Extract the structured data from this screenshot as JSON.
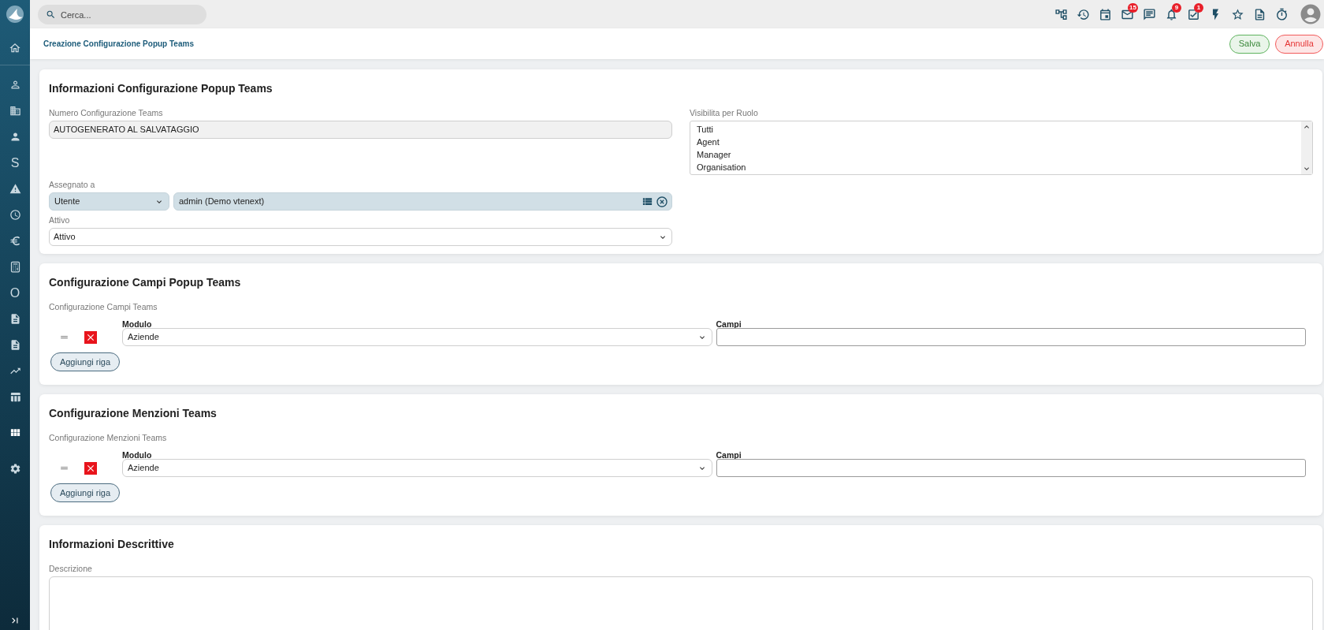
{
  "sidebar": {
    "items": [
      {
        "kind": "icon"
      },
      {
        "kind": "icon"
      },
      {
        "kind": "icon"
      },
      {
        "kind": "letter",
        "label": "S"
      },
      {
        "kind": "icon"
      },
      {
        "kind": "icon"
      },
      {
        "kind": "icon"
      },
      {
        "kind": "icon"
      },
      {
        "kind": "letter",
        "label": "O"
      },
      {
        "kind": "icon"
      },
      {
        "kind": "icon"
      },
      {
        "kind": "icon"
      },
      {
        "kind": "icon"
      }
    ]
  },
  "top_bar": {
    "search": {
      "placeholder": "Cerca..."
    },
    "badges": {
      "mail": "15",
      "notifications": "9",
      "tasks": "1"
    }
  },
  "header": {
    "title": "Creazione Configurazione Popup Teams",
    "buttons": [
      {
        "label": "Salva",
        "kind": "save"
      },
      {
        "label": "Annulla",
        "kind": "cancel"
      }
    ]
  },
  "sections": [
    {
      "title": "Informazioni Configurazione Popup Teams",
      "kind": "form",
      "rows": [
        [
          {
            "kind": "readonly",
            "label": "Numero Configurazione Teams",
            "value": "AUTOGENERATO AL SALVATAGGIO"
          },
          {
            "kind": "listbox",
            "label": "Visibilita per Ruolo",
            "options": [
              {
                "label": "Tutti",
                "selected": false
              },
              {
                "label": "Agent",
                "selected": false
              },
              {
                "label": "Manager",
                "selected": false
              },
              {
                "label": "Organisation",
                "selected": false
              }
            ]
          }
        ],
        [
          {
            "kind": "assignee",
            "label": "Assegnato a",
            "assignee_type": "Utente",
            "value": "admin (Demo vtenext)"
          }
        ],
        [
          {
            "kind": "select",
            "label": "Attivo",
            "value": "Attivo"
          }
        ]
      ]
    },
    {
      "title": "Configurazione Campi Popup Teams",
      "kind": "table",
      "label": "Configurazione Campi Teams",
      "columns": [
        "Modulo",
        "Campi"
      ],
      "rows": [
        {
          "module": "Aziende"
        }
      ],
      "add_button": "Aggiungi riga"
    },
    {
      "title": "Configurazione Menzioni Teams",
      "kind": "table",
      "label": "Configurazione Menzioni Teams",
      "columns": [
        "Modulo",
        "Campi"
      ],
      "rows": [
        {
          "module": "Aziende"
        }
      ],
      "add_button": "Aggiungi riga"
    },
    {
      "title": "Informazioni Descrittive",
      "kind": "form",
      "rows": [
        [
          {
            "kind": "textarea",
            "label": "Descrizione"
          }
        ]
      ]
    }
  ]
}
